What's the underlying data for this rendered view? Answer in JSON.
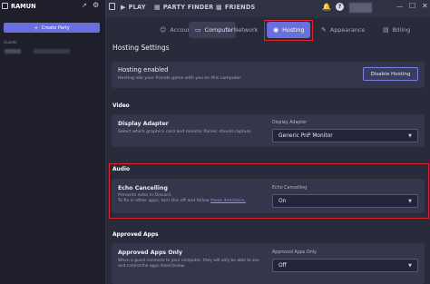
{
  "user": {
    "name": "RAMUN"
  },
  "sidebar": {
    "create_party_label": "Create Party",
    "guests_label": "Guests"
  },
  "topbar": {
    "play": "PLAY",
    "party_finder": "PARTY FINDER",
    "friends": "FRIENDS"
  },
  "tabs": [
    {
      "label": "Account",
      "icon": "user-icon"
    },
    {
      "label": "Computer",
      "icon": "monitor-icon"
    },
    {
      "label": "Network",
      "icon": "wifi-icon"
    },
    {
      "label": "Hosting",
      "icon": "broadcast-icon"
    },
    {
      "label": "Appearance",
      "icon": "brush-icon"
    },
    {
      "label": "Billing",
      "icon": "card-icon"
    }
  ],
  "page_title": "Hosting Settings",
  "hosting": {
    "title": "Hosting enabled",
    "desc": "Hosting lets your friends game with you on this computer",
    "button": "Disable Hosting"
  },
  "video": {
    "section": "Video",
    "title": "Display Adapter",
    "desc": "Select which graphics card and monitor Parsec should capture.",
    "dropdown_label": "Display Adapter",
    "dropdown_value": "Generic PnP Monitor"
  },
  "audio": {
    "section": "Audio",
    "title": "Echo Cancelling",
    "desc_line1": "Prevents echo in Discord.",
    "desc_line2": "To fix in other apps, turn this off and follow",
    "desc_link": "these directions.",
    "dropdown_label": "Echo Cancelling",
    "dropdown_value": "On"
  },
  "approved": {
    "section": "Approved Apps",
    "title": "Approved Apps Only",
    "desc_line1": "When a guest connects to your computer, they will only be able to see",
    "desc_line2": "and control the apps listed below.",
    "dropdown_label": "Approved Apps Only",
    "dropdown_value": "Off"
  },
  "colors": {
    "accent": "#6a6fe0",
    "highlight": "#e0252a",
    "link": "#8f93ff"
  }
}
